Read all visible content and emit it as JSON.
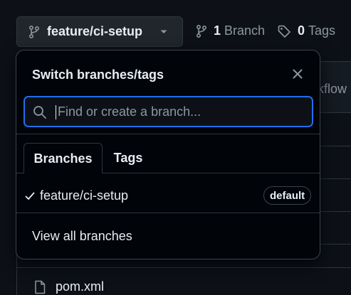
{
  "branch_selector": {
    "current": "feature/ci-setup"
  },
  "repo_meta": {
    "branch_count": "1",
    "branch_label": "Branch",
    "tag_count": "0",
    "tag_label": "Tags"
  },
  "background": {
    "header_fragment": "kflow",
    "file_name": "pom.xml"
  },
  "popover": {
    "title": "Switch branches/tags",
    "search": {
      "placeholder": "Find or create a branch...",
      "value": ""
    },
    "tabs": [
      {
        "label": "Branches",
        "active": true
      },
      {
        "label": "Tags",
        "active": false
      }
    ],
    "branches": [
      {
        "name": "feature/ci-setup",
        "selected": true,
        "badge": "default"
      }
    ],
    "view_all_label": "View all branches"
  },
  "colors": {
    "background": "#0d1117",
    "popover_bg": "#010409",
    "accent_focus": "#1f6feb",
    "muted_text": "#8d96a0"
  }
}
